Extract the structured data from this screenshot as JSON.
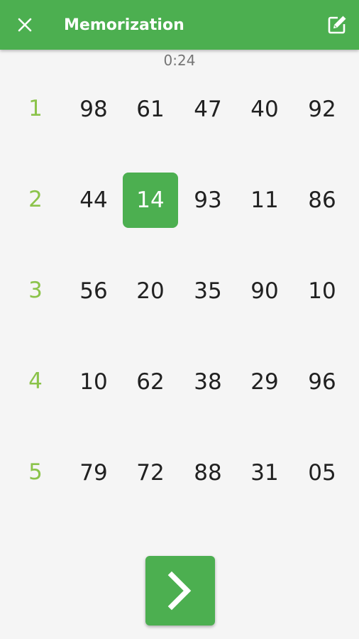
{
  "app_bar": {
    "title": "Memorization",
    "close_icon": "close-icon",
    "edit_icon": "edit-icon"
  },
  "timer": "0:24",
  "grid": {
    "rows": [
      {
        "label": "1",
        "cells": [
          "98",
          "61",
          "47",
          "40",
          "92"
        ]
      },
      {
        "label": "2",
        "cells": [
          "44",
          "14",
          "93",
          "11",
          "86"
        ]
      },
      {
        "label": "3",
        "cells": [
          "56",
          "20",
          "35",
          "90",
          "10"
        ]
      },
      {
        "label": "4",
        "cells": [
          "10",
          "62",
          "38",
          "29",
          "96"
        ]
      },
      {
        "label": "5",
        "cells": [
          "79",
          "72",
          "88",
          "31",
          "05"
        ]
      }
    ],
    "selected": {
      "row": 2,
      "col": 2
    }
  },
  "next_button": {
    "icon": "chevron-right-icon"
  },
  "colors": {
    "primary": "#4caf50",
    "row_label": "#8bc34a",
    "text": "#212121",
    "timer": "#757575",
    "background": "#f5f5f5"
  }
}
